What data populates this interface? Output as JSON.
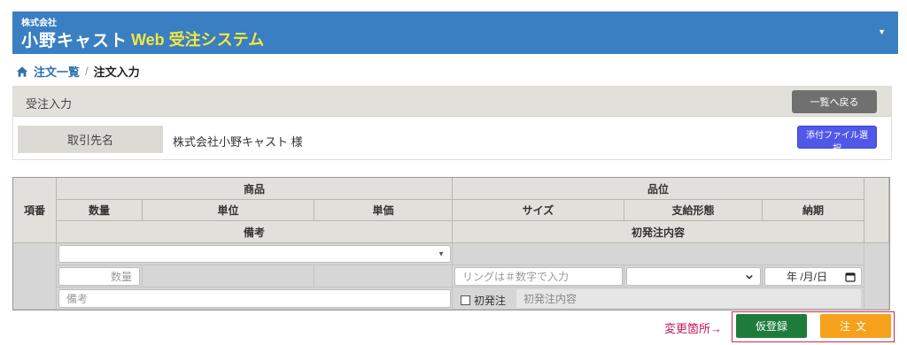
{
  "header": {
    "company_small": "株式会社",
    "company_name": "小野キャスト",
    "system_title": "Web 受注システム",
    "caret": "▼"
  },
  "breadcrumb": {
    "parent": "注文一覧",
    "separator": "/",
    "current": "注文入力"
  },
  "panel": {
    "title": "受注入力",
    "back_button": "一覧へ戻る",
    "customer_label": "取引先名",
    "customer_value": "株式会社小野キャスト 様",
    "attach_button": "添付ファイル選択"
  },
  "table": {
    "headers": {
      "item_no": "項番",
      "product": "商品",
      "quality": "品位",
      "quantity": "数量",
      "unit": "単位",
      "unit_price": "単価",
      "size": "サイズ",
      "supply_form": "支給形態",
      "delivery": "納期",
      "remarks": "備考",
      "first_order_content": "初発注内容"
    },
    "row": {
      "product_select_value": "",
      "quantity_placeholder": "数量",
      "size_placeholder": "リングは＃数字で入力",
      "supply_select_value": "",
      "date_placeholder": "年 /月/日",
      "remarks_placeholder": "備考",
      "first_order_checkbox_label": "初発注",
      "first_order_content_placeholder": "初発注内容"
    }
  },
  "actions": {
    "change_note": "変更箇所→",
    "temp_register": "仮登録",
    "order": "注文"
  },
  "colors": {
    "header_bg": "#3a7fc1",
    "title_accent": "#f4e73f",
    "temp_button": "#1e7c3a",
    "order_button": "#f5a11c",
    "highlight": "#cf2a4a",
    "attach_button": "#5158e8"
  }
}
